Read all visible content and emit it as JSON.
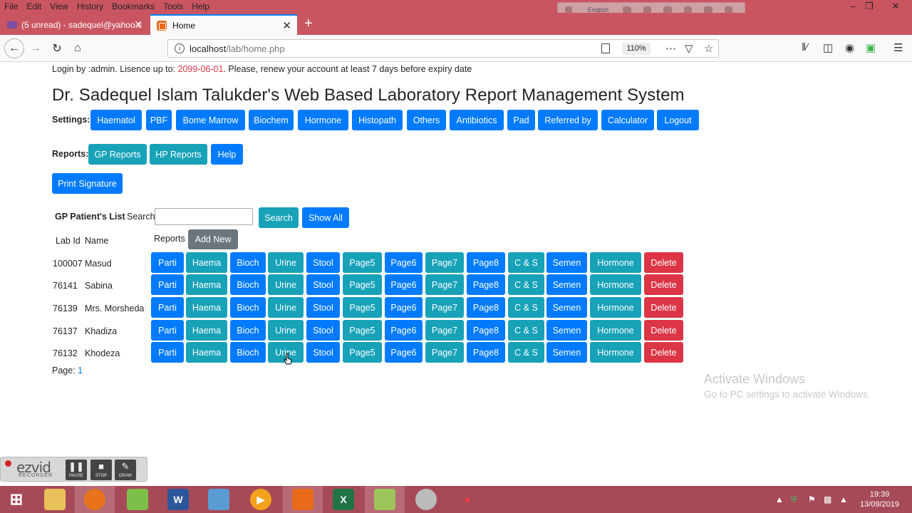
{
  "browser": {
    "menu": [
      "File",
      "Edit",
      "View",
      "History",
      "Bookmarks",
      "Tools",
      "Help"
    ],
    "ime_language": "English",
    "tabs": [
      {
        "title": "(5 unread) - sadequel@yahoo.c"
      },
      {
        "title": "Home"
      }
    ],
    "url_host": "localhost",
    "url_path": "/lab/home.php",
    "zoom": "110%"
  },
  "page": {
    "license_prefix": "Login by :admin. Lisence up to: ",
    "license_date": "2099-06-01",
    "license_suffix": ". Please, renew your account at least 7 days before expiry date",
    "title": "Dr. Sadequel Islam Talukder's Web Based Laboratory Report Management System",
    "settings_label": "Settings:",
    "settings_buttons": [
      "Haematol",
      "PBF",
      "Bome Marrow",
      "Biochem",
      "Hormone",
      "Histopath",
      "Others",
      "Antibiotics",
      "Pad",
      "Referred by",
      "Calculator",
      "Logout"
    ],
    "reports_label": "Reports:",
    "reports_buttons": [
      "GP Reports",
      "HP Reports",
      "Help"
    ],
    "print_signature": "Print Signature",
    "list_title": "GP Patient's List",
    "search_label": "Search:",
    "search_value": "",
    "search_button": "Search",
    "show_all_button": "Show All",
    "columns": {
      "lab_id": "Lab Id",
      "name": "Name",
      "reports": "Reports"
    },
    "add_new": "Add New",
    "row_buttons": [
      "Parti",
      "Haema",
      "Bioch",
      "Urine",
      "Stool",
      "Page5",
      "Page6",
      "Page7",
      "Page8",
      "C & S",
      "Semen",
      "Hormone",
      "Delete"
    ],
    "patients": [
      {
        "lab_id": "100007",
        "name": "Masud"
      },
      {
        "lab_id": "76141",
        "name": "Sabina"
      },
      {
        "lab_id": "76139",
        "name": "Mrs. Morsheda"
      },
      {
        "lab_id": "76137",
        "name": "Khadiza"
      },
      {
        "lab_id": "76132",
        "name": "Khodeza"
      }
    ],
    "page_label": "Page:",
    "page_number": "1"
  },
  "watermark": {
    "line1": "Activate Windows",
    "line2": "Go to PC settings to activate Windows."
  },
  "ezvid": {
    "logo": "ezvid",
    "sub": "RECORDER",
    "buttons": [
      "PAUSE",
      "STOP",
      "DRAW"
    ]
  },
  "taskbar": {
    "time": "19:39",
    "date": "13/09/2019"
  },
  "colors": {
    "primary": "#007bff",
    "info": "#17a2b8",
    "danger": "#dc3545",
    "secondary": "#6c757d",
    "browser_chrome": "#c95561",
    "taskbar": "#a64a58"
  }
}
